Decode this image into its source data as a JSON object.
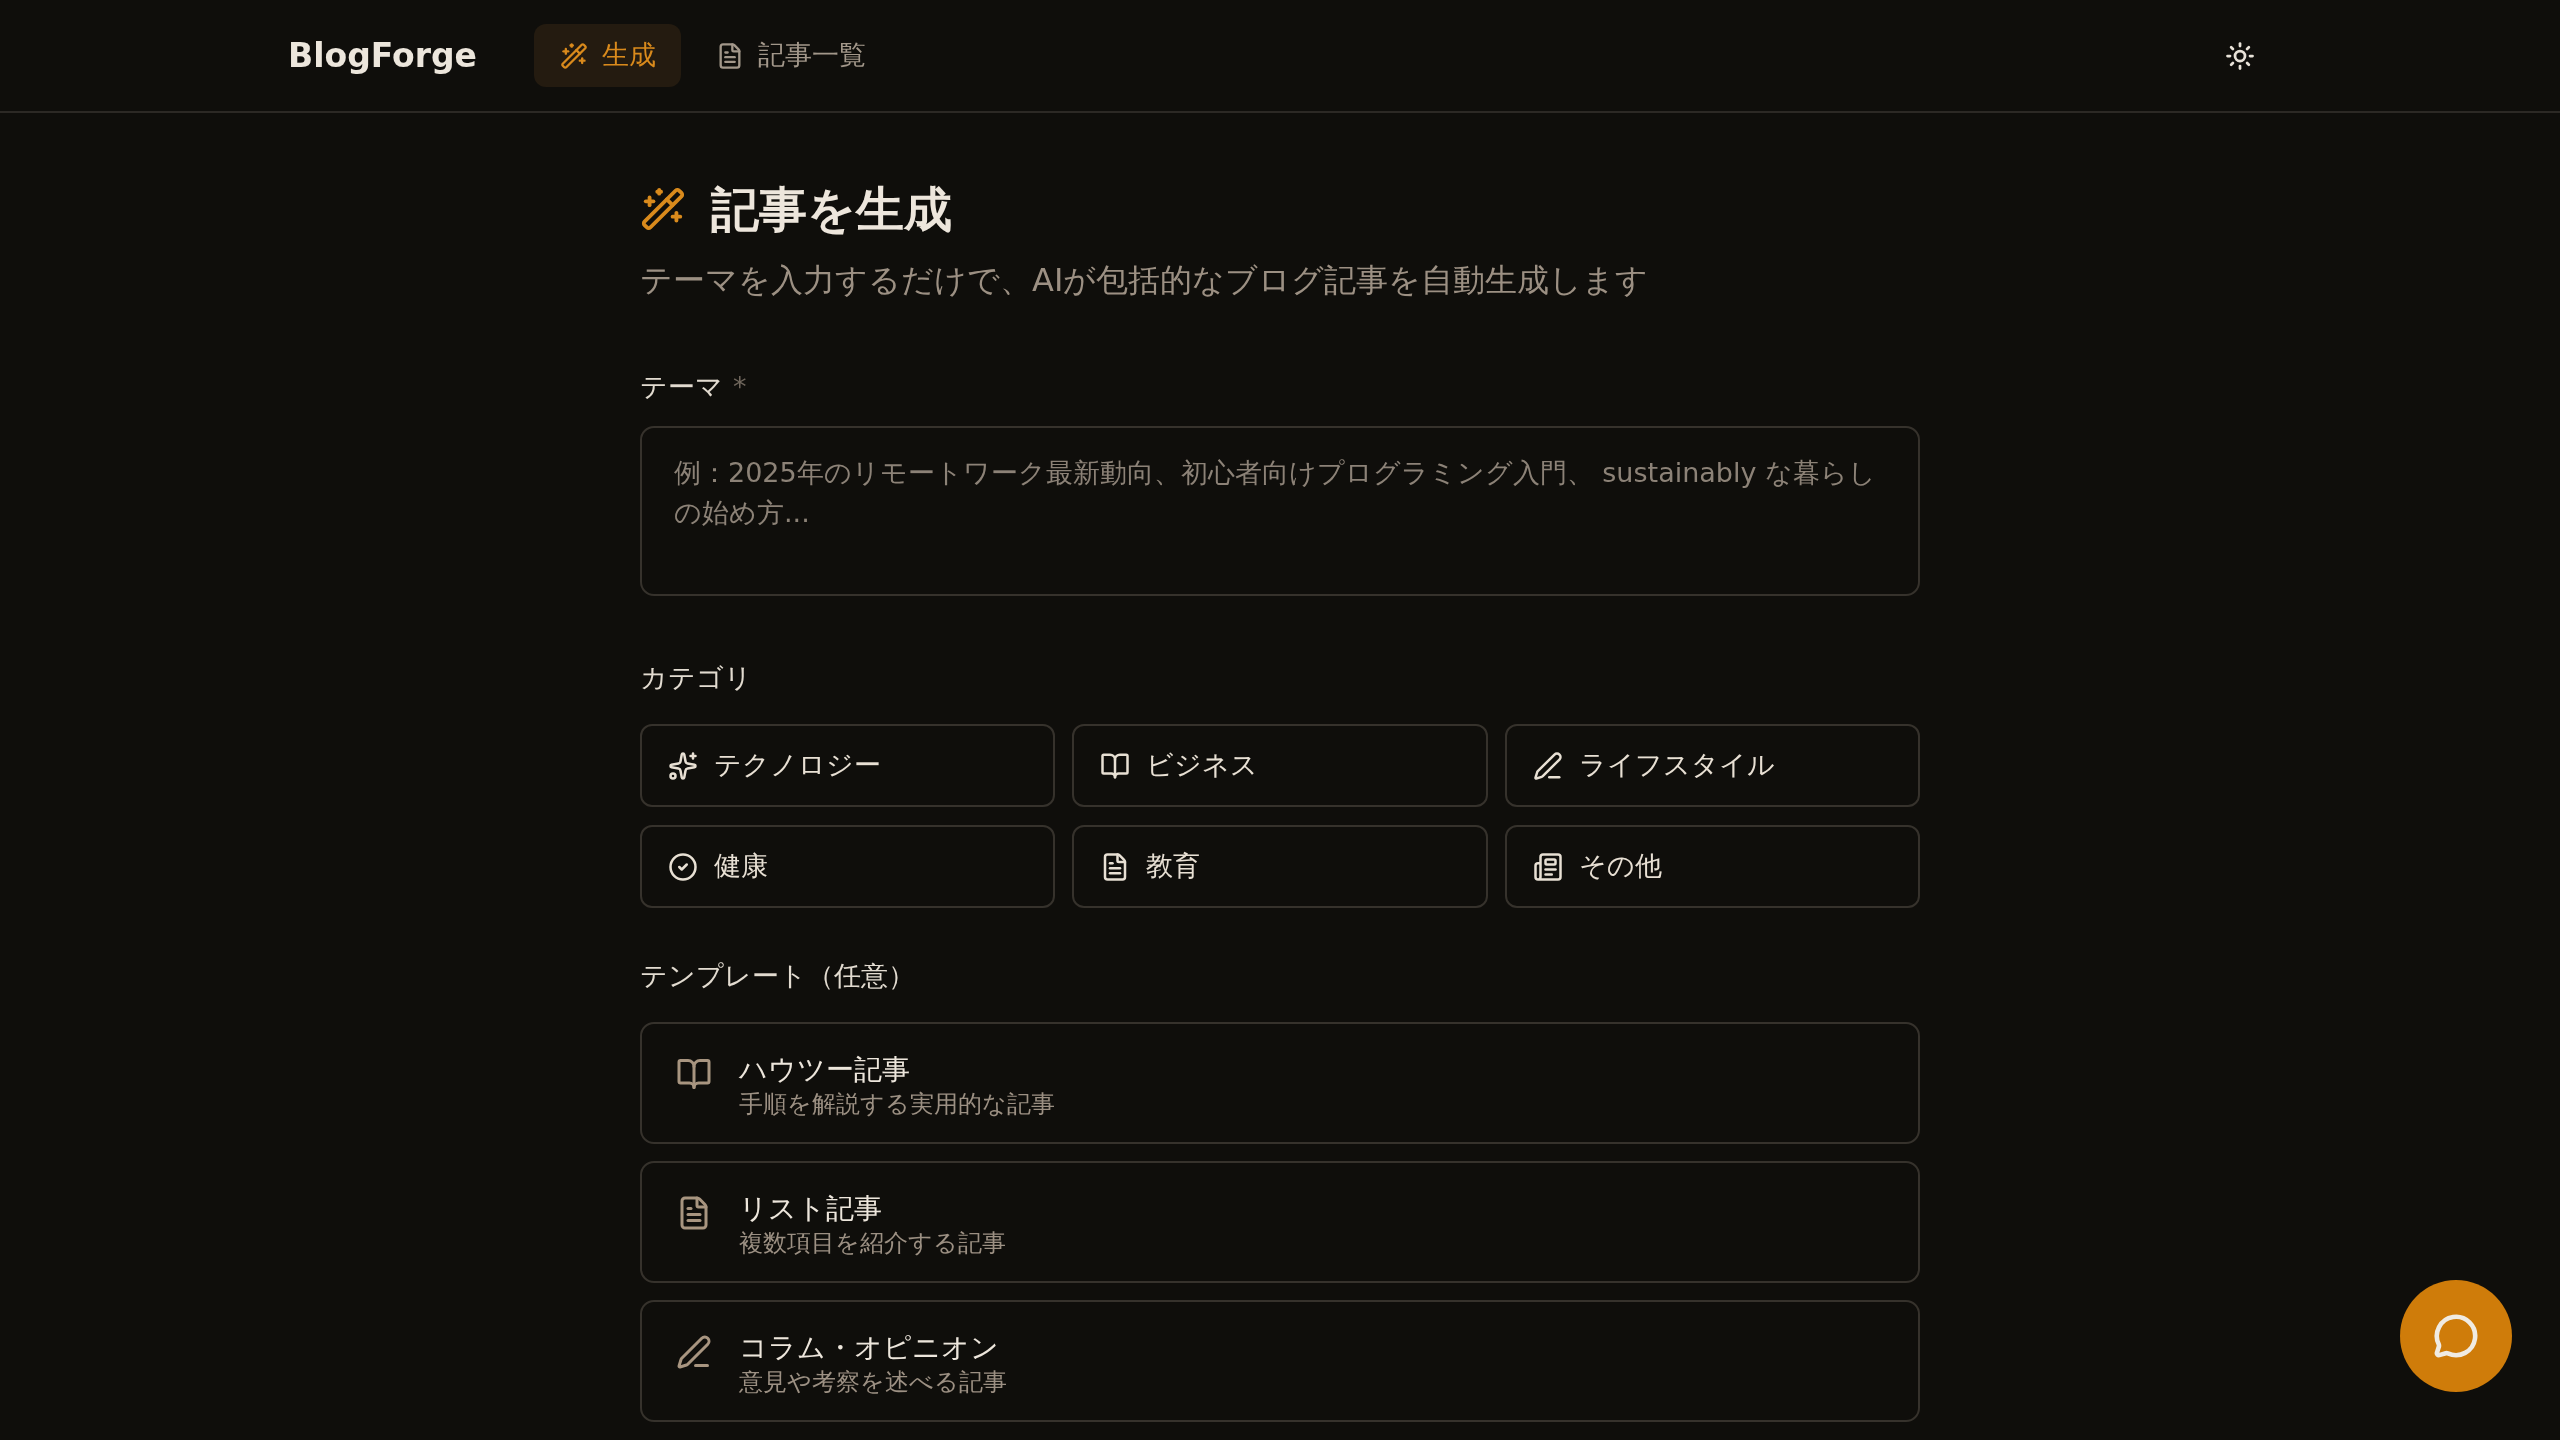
{
  "header": {
    "logo": "BlogForge",
    "nav": [
      {
        "label": "生成",
        "selected": true
      },
      {
        "label": "記事一覧",
        "selected": false
      }
    ]
  },
  "page": {
    "title": "記事を生成",
    "subtitle": "テーマを入力するだけで、AIが包括的なブログ記事を自動生成します"
  },
  "theme_field": {
    "label": "テーマ",
    "required_mark": "*",
    "placeholder": "例：2025年のリモートワーク最新動向、初心者向けプログラミング入門、 sustainably な暮らしの始め方..."
  },
  "categories": {
    "label": "カテゴリ",
    "items": [
      {
        "label": "テクノロジー",
        "selected": false
      },
      {
        "label": "ビジネス",
        "selected": false
      },
      {
        "label": "ライフスタイル",
        "selected": false
      },
      {
        "label": "健康",
        "selected": false
      },
      {
        "label": "教育",
        "selected": false
      },
      {
        "label": "その他",
        "selected": false
      }
    ]
  },
  "templates": {
    "label": "テンプレート（任意）",
    "items": [
      {
        "title": "ハウツー記事",
        "description": "手順を解説する実用的な記事",
        "selected": false
      },
      {
        "title": "リスト記事",
        "description": "複数項目を紹介する記事",
        "selected": false
      },
      {
        "title": "コラム・オピニオン",
        "description": "意見や考察を述べる記事",
        "selected": false
      }
    ]
  }
}
